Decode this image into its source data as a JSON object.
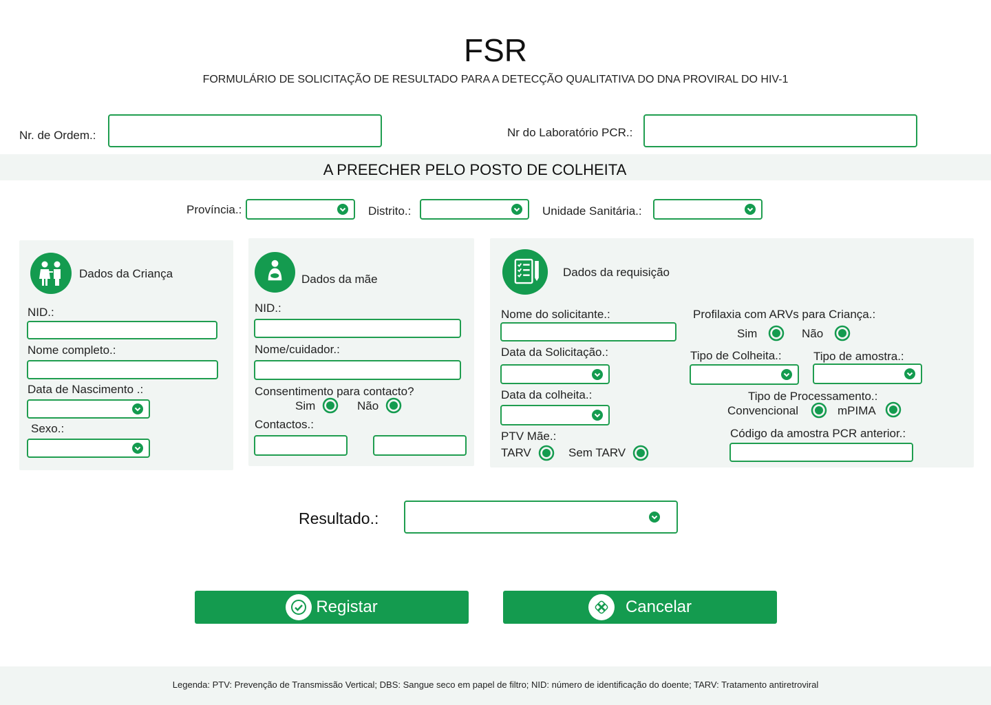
{
  "header": {
    "title": "FSR",
    "subtitle": "FORMULÁRIO DE SOLICITAÇÃO DE RESULTADO PARA A DETECÇÃO QUALITATIVA DO DNA PROVIRAL DO HIV-1"
  },
  "top_fields": {
    "ordem_label": "Nr. de Ordem.:",
    "lab_label": "Nr do Laboratório PCR.:"
  },
  "section_banner": "A PREECHER PELO POSTO DE COLHEITA",
  "location": {
    "provincia_label": "Província.:",
    "distrito_label": "Distrito.:",
    "unidade_label": "Unidade Sanitária.:"
  },
  "crianca": {
    "title": "Dados da Criança",
    "nid_label": "NID.:",
    "nome_label": "Nome completo.:",
    "nascimento_label": "Data de Nascimento .:",
    "sexo_label": "Sexo.:"
  },
  "mae": {
    "title": "Dados da mãe",
    "nid_label": "NID.:",
    "nome_label": "Nome/cuidador.:",
    "consentimento_label": "Consentimento para contacto?",
    "sim_label": "Sim",
    "nao_label": "Não",
    "contactos_label": "Contactos.:"
  },
  "requisicao": {
    "title": "Dados da requisição",
    "solicitante_label": "Nome do solicitante.:",
    "data_solicitacao_label": "Data da Solicitação.:",
    "data_colheita_label": "Data da colheita.:",
    "ptv_label": "PTV Mãe.:",
    "tarv_label": "TARV",
    "sem_tarv_label": "Sem TARV",
    "profilaxia_label": "Profilaxia com ARVs para Criança.:",
    "sim_label": "Sim",
    "nao_label": "Não",
    "tipo_colheita_label": "Tipo de Colheita.:",
    "tipo_amostra_label": "Tipo de amostra.:",
    "tipo_processamento_label": "Tipo de Processamento.:",
    "convencional_label": "Convencional",
    "mpima_label": "mPIMA",
    "codigo_label": "Código da amostra PCR anterior.:"
  },
  "resultado_label": "Resultado.:",
  "buttons": {
    "registar": "Registar",
    "cancelar": "Cancelar"
  },
  "footer": {
    "legenda": "Legenda: PTV: Prevenção de Transmissão Vertical; DBS: Sangue seco em papel de filtro; NID: número de identificação do doente; TARV: Tratamento antiretroviral"
  },
  "icons": [
    "children-icon",
    "mother-icon",
    "clipboard-icon",
    "dropdown-arrow-icon",
    "radio-icon",
    "check-icon",
    "cancel-icon"
  ],
  "colors": {
    "accent": "#149b4f",
    "panel": "#f1f5f3"
  }
}
